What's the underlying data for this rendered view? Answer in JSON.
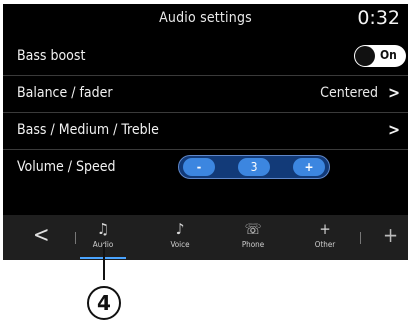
{
  "header": {
    "title": "Audio settings",
    "clock": "0:32"
  },
  "rows": {
    "bass_boost": {
      "label": "Bass boost",
      "toggle_label": "On"
    },
    "balance": {
      "label": "Balance / fader",
      "value": "Centered",
      "chevron": ">"
    },
    "eq": {
      "label": "Bass / Medium / Treble",
      "chevron": ">"
    },
    "volume_speed": {
      "label": "Volume / Speed",
      "minus": "-",
      "value": "3",
      "plus": "+"
    }
  },
  "navbar": {
    "back_glyph": "<",
    "tabs": [
      {
        "label": "Audio",
        "icon": "music-note-icon",
        "glyph": "♫"
      },
      {
        "label": "Voice",
        "icon": "voice-icon",
        "glyph": "♪"
      },
      {
        "label": "Phone",
        "icon": "phone-icon",
        "glyph": "☏"
      },
      {
        "label": "Other",
        "icon": "plus-icon",
        "glyph": "+"
      }
    ],
    "extra_glyph": "+"
  },
  "callout": {
    "number": "4"
  },
  "colors": {
    "accent": "#3c86e0",
    "background": "#000000",
    "navbar": "#1f1f1f"
  }
}
